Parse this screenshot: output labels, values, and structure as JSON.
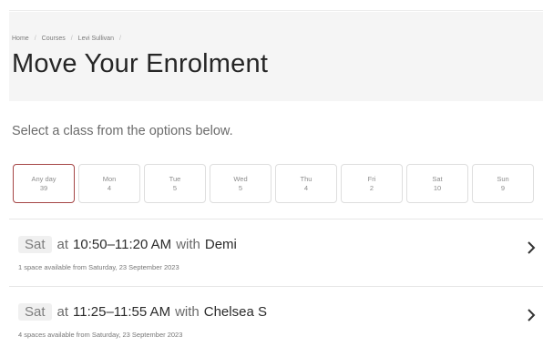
{
  "breadcrumb": [
    "Home",
    "Courses",
    "Levi Sullivan"
  ],
  "title": "Move Your Enrolment",
  "instructions": "Select a class from the options below.",
  "days": [
    {
      "label": "Any day",
      "count": "39"
    },
    {
      "label": "Mon",
      "count": "4"
    },
    {
      "label": "Tue",
      "count": "5"
    },
    {
      "label": "Wed",
      "count": "5"
    },
    {
      "label": "Thu",
      "count": "4"
    },
    {
      "label": "Fri",
      "count": "2"
    },
    {
      "label": "Sat",
      "count": "10"
    },
    {
      "label": "Sun",
      "count": "9"
    }
  ],
  "classes": [
    {
      "day": "Sat",
      "at": "at",
      "time": "10:50–11:20 AM",
      "with": "with",
      "instructor": "Demi",
      "availability": "1 space available from Saturday, 23 September 2023"
    },
    {
      "day": "Sat",
      "at": "at",
      "time": "11:25–11:55 AM",
      "with": "with",
      "instructor": "Chelsea S",
      "availability": "4 spaces available from Saturday, 23 September 2023"
    }
  ],
  "colors": {
    "selected_border": "#a54646",
    "header_bg": "#f5f5f5"
  },
  "icons": {
    "row_arrow": "chevron-right-icon"
  }
}
